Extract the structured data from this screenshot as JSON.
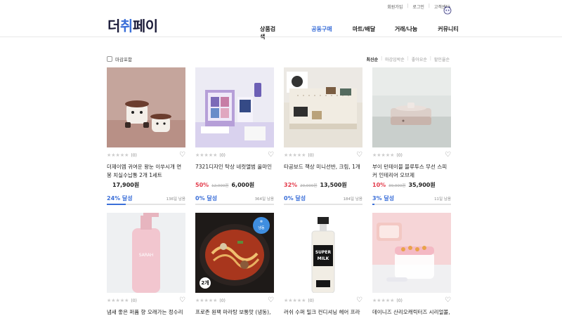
{
  "header": {
    "util_links": [
      "회원가입",
      "로그인",
      "고객센터"
    ],
    "logo": {
      "part1": "더",
      "part2": "취",
      "part3": "페이"
    },
    "nav": [
      "상품검색",
      "공동구매",
      "마트/배달",
      "거래/나눔",
      "커뮤니티"
    ],
    "active_nav": "공동구매"
  },
  "filter": {
    "checkbox_label": "마감포함",
    "sort_options": [
      "최신순",
      "마감임박순",
      "좋아요순",
      "할인율순"
    ],
    "active_sort": "최신순"
  },
  "products": [
    {
      "title": "더제이엠 귀여운 왕눈 이쑤시개 면봉 치실수납통 2개 1세트",
      "discount": "",
      "original_price": "",
      "price": "17,900원",
      "rating_count": "(0)",
      "progress_label": "24% 달성",
      "progress": 0.24,
      "remaining": "136일 남음"
    },
    {
      "title": "7321디자인 탁상 네컷앨범 올마인",
      "discount": "50%",
      "original_price": "12,000원",
      "price": "6,000원",
      "rating_count": "(0)",
      "progress_label": "0% 달성",
      "progress": 0.0,
      "remaining": "364일 남음"
    },
    {
      "title": "타공보드 책상 미니선반, 크림, 1개",
      "discount": "32%",
      "original_price": "20,000원",
      "price": "13,500원",
      "rating_count": "(0)",
      "progress_label": "0% 달성",
      "progress": 0.0,
      "remaining": "184일 남음"
    },
    {
      "title": "부이 턴테이블 블루투스 무선 스피커 인테리어 오브제",
      "discount": "10%",
      "original_price": "39,900원",
      "price": "35,900원",
      "rating_count": "(0)",
      "progress_label": "3% 달성",
      "progress": 0.03,
      "remaining": "11일 남음"
    },
    {
      "title": "냄새 좋은 퍼퓸 향 오래가는 정수리 두",
      "rating_count": "(0)"
    },
    {
      "title": "프로존 원팩 마라탕 보통맛 (냉동),",
      "rating_count": "(0)",
      "frozen_badge": "냉동",
      "count_badge": "2개"
    },
    {
      "title": "러쉬 수퍼 밀크 컨디셔닝 헤어 프라이",
      "rating_count": "(0)"
    },
    {
      "title": "데이니즈 산리오캐릭터즈 시리얼볼,",
      "rating_count": "(0)"
    }
  ],
  "icons": {
    "star": "star-icon",
    "heart": "heart-icon",
    "checkbox": "checkbox-icon"
  },
  "colors": {
    "accent": "#3b6fd8",
    "discount": "#e33b4b"
  }
}
